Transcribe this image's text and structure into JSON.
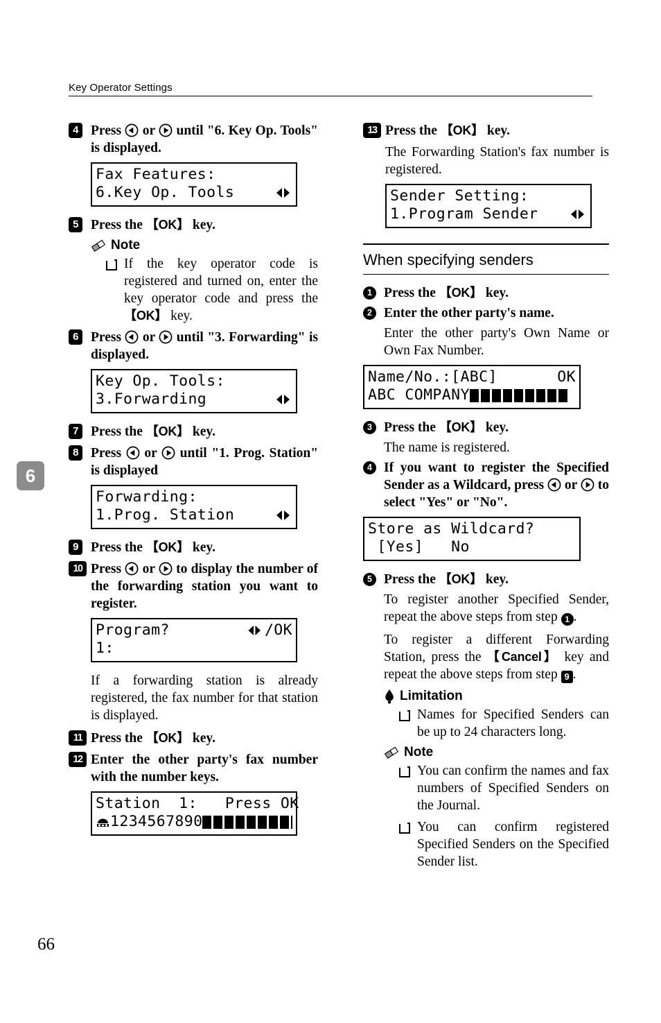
{
  "header": {
    "title": "Key Operator Settings"
  },
  "chapter_tab": "6",
  "page_number": "66",
  "icons": {
    "note": "pencil-eraser-icon",
    "limitation": "exclamation-bulb-icon",
    "arrow_left": "circled-left-arrow-icon",
    "arrow_right": "circled-right-arrow-icon",
    "lcd_selector": "lcd-left-right-arrows-icon",
    "phone": "lcd-telephone-icon"
  },
  "keys": {
    "ok": "OK",
    "cancel": "Cancel",
    "bracket_open": "【",
    "bracket_close": "】"
  },
  "left_column": {
    "step4": {
      "number": "4",
      "text_before_arrows": "Press",
      "text_mid": "or",
      "text_after": "until \"6. Key Op. Tools\" is displayed.",
      "lcd": {
        "line1": "Fax Features:",
        "line2": "6.Key Op. Tools",
        "has_selector": true
      }
    },
    "step5": {
      "number": "5",
      "text_a": "Press the",
      "text_b": "key.",
      "note_title": "Note",
      "note_items": [
        "If the key operator code is registered and turned on, enter the key operator code and press the 【OK】 key."
      ],
      "note_item_prefix": "If the key operator code is registered and turned on, enter the key operator code and press the",
      "note_item_suffix": "key."
    },
    "step6": {
      "number": "6",
      "text_before_arrows": "Press",
      "text_mid": "or",
      "text_after": "until \"3. Forwarding\" is displayed.",
      "lcd": {
        "line1": "Key Op. Tools:",
        "line2": "3.Forwarding",
        "has_selector": true
      }
    },
    "step7": {
      "number": "7",
      "text_a": "Press the",
      "text_b": "key."
    },
    "step8": {
      "number": "8",
      "text_before_arrows": "Press",
      "text_mid": "or",
      "text_after": "until \"1. Prog. Station\" is displayed",
      "lcd": {
        "line1": "Forwarding:",
        "line2": "1.Prog. Station",
        "has_selector": true
      }
    },
    "step9": {
      "number": "9",
      "text_a": "Press the",
      "text_b": "key."
    },
    "step10": {
      "number": "10",
      "text_before_arrows": "Press",
      "text_mid": "or",
      "text_after": "to display the number of the forwarding station you want to register.",
      "lcd": {
        "line1_left": "Program?",
        "line1_right": "/OK",
        "line2": "1:"
      },
      "after_text": "If a forwarding station is already registered, the fax number for that station is displayed."
    },
    "step11": {
      "number": "11",
      "text_a": "Press the",
      "text_b": "key."
    },
    "step12": {
      "number": "12",
      "text": "Enter the other party's fax number with the number keys.",
      "lcd": {
        "line1": "Station  1:   Press OK",
        "line2_digits": "1234567890",
        "line2_blocks": 10
      }
    }
  },
  "right_column": {
    "step13": {
      "number": "13",
      "text_a": "Press the",
      "text_b": "key.",
      "para": "The Forwarding Station's fax number is registered.",
      "lcd": {
        "line1": "Sender Setting:",
        "line2": "1.Program Sender",
        "has_selector": true
      }
    },
    "section_title": "When specifying senders",
    "cstep1": {
      "number": "1",
      "text_a": "Press the",
      "text_b": "key."
    },
    "cstep2": {
      "number": "2",
      "text": "Enter the other party's name.",
      "para": "Enter the other party's Own Name or Own Fax Number.",
      "lcd": {
        "line1_left": "Name/No.:[ABC]",
        "line1_right": "OK",
        "line2_text": "ABC COMPANY",
        "line2_blocks": 9
      }
    },
    "cstep3": {
      "number": "3",
      "text_a": "Press the",
      "text_b": "key.",
      "para": "The name is registered."
    },
    "cstep4": {
      "number": "4",
      "text_before": "If you want to register the Specified Sender as a Wildcard, press",
      "text_mid": "or",
      "text_after": "to select \"Yes\" or \"No\".",
      "lcd": {
        "line1": "Store as Wildcard?",
        "line2": " [Yes]   No"
      }
    },
    "cstep5": {
      "number": "5",
      "text_a": "Press the",
      "text_b": "key.",
      "para1_a": "To register another Specified Sender, repeat the above steps from step",
      "para1_badge": "1",
      "para1_b": ".",
      "para2_a": "To register a different Forwarding Station, press the",
      "para2_key": "Cancel",
      "para2_b": "key and repeat the above steps from step",
      "para2_badge": "9",
      "para2_c": "."
    },
    "limitation_title": "Limitation",
    "limitation_items": [
      "Names for Specified Senders can be up to 24 characters long."
    ],
    "note_title": "Note",
    "note_items": [
      "You can confirm the names and fax numbers of Specified Senders on the Journal.",
      "You can confirm registered Specified Senders on the Specified Sender list."
    ]
  }
}
